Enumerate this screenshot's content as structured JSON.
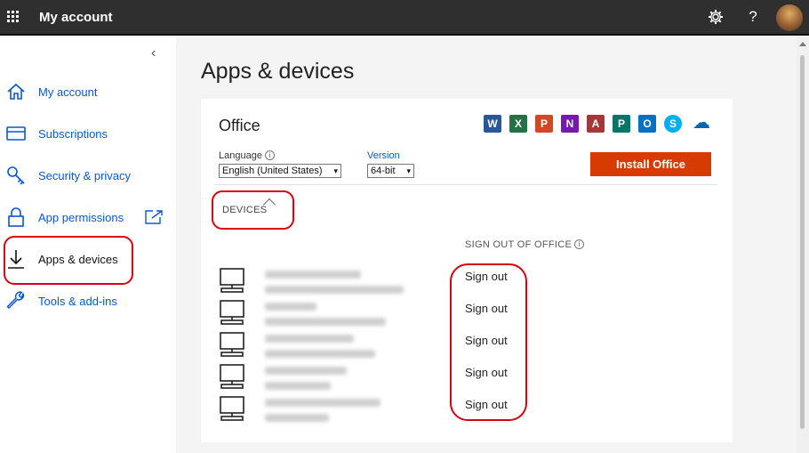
{
  "header": {
    "app_title": "My account",
    "settings_icon": "gear-icon",
    "help_label": "?",
    "avatar_icon": "avatar-photo"
  },
  "sidebar": {
    "collapse_glyph": "‹",
    "items": [
      {
        "label": "My account",
        "icon": "home-icon"
      },
      {
        "label": "Subscriptions",
        "icon": "card-icon"
      },
      {
        "label": "Security & privacy",
        "icon": "key-icon"
      },
      {
        "label": "App permissions",
        "icon": "lock-icon"
      },
      {
        "label": "Apps & devices",
        "icon": "download-icon"
      },
      {
        "label": "Tools & add-ins",
        "icon": "wrench-icon"
      }
    ]
  },
  "main": {
    "page_title": "Apps & devices",
    "office": {
      "title": "Office",
      "apps": [
        {
          "letter": "W",
          "color": "#2b579a"
        },
        {
          "letter": "X",
          "color": "#217346"
        },
        {
          "letter": "P",
          "color": "#d24726"
        },
        {
          "letter": "N",
          "color": "#7719aa"
        },
        {
          "letter": "A",
          "color": "#a4373a"
        },
        {
          "letter": "P",
          "color": "#077568"
        },
        {
          "letter": "O",
          "color": "#0072c6"
        },
        {
          "letter": "S",
          "color": "#00aff0"
        },
        {
          "letter": "☁",
          "color": "#0364b8"
        }
      ],
      "language_label": "Language",
      "language_value": "English (United States)",
      "version_label": "Version",
      "version_value": "64-bit",
      "install_label": "Install Office",
      "install_color": "#d83b01"
    },
    "devices": {
      "label": "DEVICES",
      "signout_header": "SIGN OUT OF OFFICE",
      "signout_label": "Sign out",
      "rows": 5
    }
  }
}
